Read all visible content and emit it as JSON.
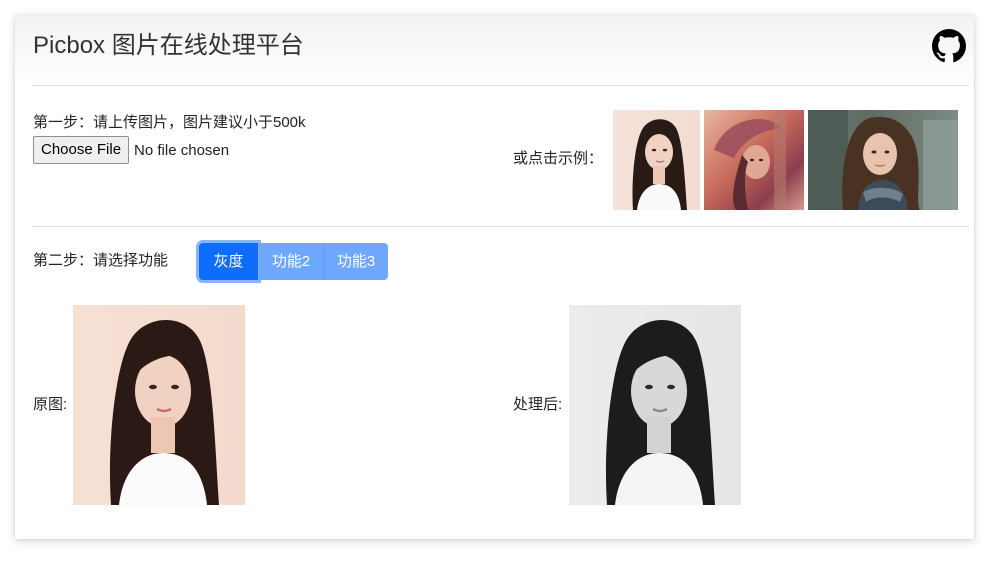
{
  "header": {
    "title": "Picbox 图片在线处理平台",
    "github_icon": "github-icon"
  },
  "step1": {
    "label": "第一步：请上传图片，图片建议小于500k",
    "choose_file_label": "Choose File",
    "no_file_text": "No file chosen",
    "examples_label": "或点击示例：",
    "examples": [
      "portrait-woman-light",
      "lena-classic",
      "portrait-woman-scarf"
    ]
  },
  "step2": {
    "label": "第二步：请选择功能",
    "functions": [
      "灰度",
      "功能2",
      "功能3"
    ],
    "active_index": 0
  },
  "result": {
    "original_label": "原图:",
    "processed_label": "处理后:"
  },
  "colors": {
    "primary": "#0d6efd",
    "primary_light": "#6ea8fe",
    "divider": "#dcdcdc"
  }
}
